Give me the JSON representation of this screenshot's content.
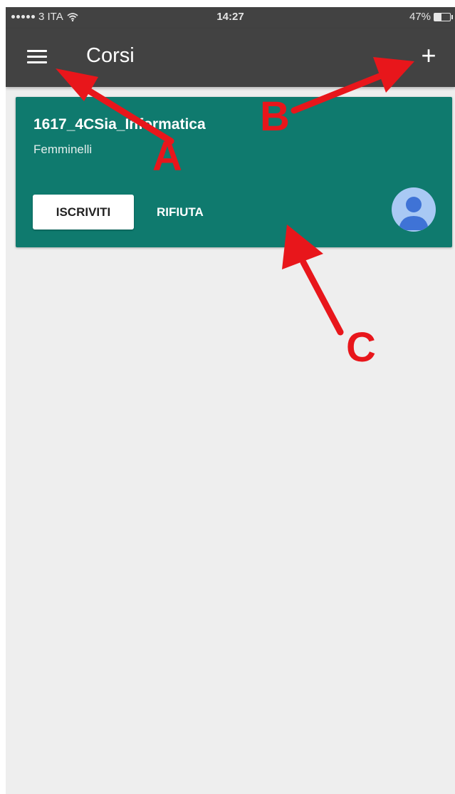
{
  "status_bar": {
    "carrier": "3 ITA",
    "time": "14:27",
    "battery_level": "47%",
    "battery_fraction": 0.47
  },
  "app_bar": {
    "title": "Corsi",
    "menu_icon": "hamburger-menu-icon",
    "add_icon": "plus-icon",
    "add_label": "+"
  },
  "course_card": {
    "name": "1617_4CSia_Informatica",
    "teacher": "Femminelli",
    "join_label": "ISCRIVITI",
    "decline_label": "RIFIUTA",
    "avatar_icon": "person-avatar-icon",
    "color": "#0f7a6e"
  },
  "annotations": {
    "color": "#e8161b",
    "labels": [
      "A",
      "B",
      "C"
    ]
  },
  "colors": {
    "app_bar": "#424242",
    "background": "#eeeeee",
    "avatar_bg": "#a9c9f4",
    "avatar_fg": "#3f73d6"
  }
}
